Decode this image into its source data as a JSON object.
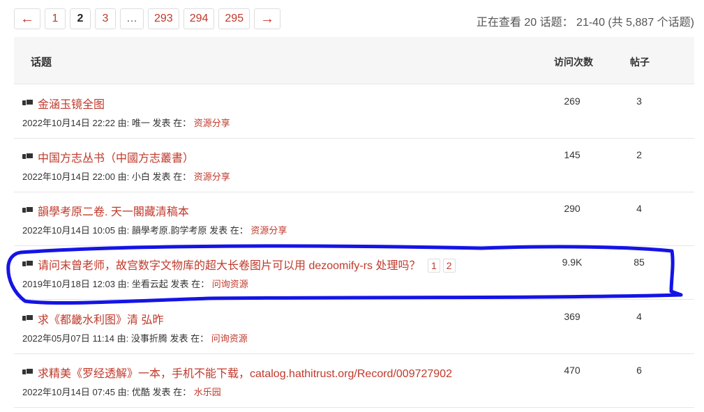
{
  "pagination": {
    "prev": "←",
    "pages": [
      "1",
      "2",
      "3",
      "…",
      "293",
      "294",
      "295"
    ],
    "current": "2",
    "next": "→"
  },
  "viewing_text": "正在查看 20 话题： 21-40 (共 5,887 个话题)",
  "table_header": {
    "topic": "话题",
    "views": "访问次数",
    "posts": "帖子"
  },
  "rows": [
    {
      "title": "金涵玉镜全图",
      "date": "2022年10月14日 22:22",
      "by": "由:",
      "author": "唯一",
      "posted_in": "发表 在：",
      "forum": "资源分享",
      "views": "269",
      "posts": "3"
    },
    {
      "title": "中国方志丛书（中國方志叢書）",
      "date": "2022年10月14日 22:00",
      "by": "由:",
      "author": "小白",
      "posted_in": "发表 在：",
      "forum": "资源分享",
      "views": "145",
      "posts": "2"
    },
    {
      "title": "韻學考原二卷. 天一閣藏清稿本",
      "date": "2022年10月14日 10:05",
      "by": "由:",
      "author": "韻學考原.韵学考原",
      "posted_in": "发表 在：",
      "forum": "资源分享",
      "views": "290",
      "posts": "4"
    },
    {
      "title": "请问末曾老师，故宫数字文物库的超大长卷图片可以用 dezoomify-rs 处理吗？",
      "subpages": [
        "1",
        "2"
      ],
      "date": "2019年10月18日 12:03",
      "by": "由:",
      "author": "坐看云起",
      "posted_in": "发表 在：",
      "forum": "问询资源",
      "views": "9.9K",
      "posts": "85"
    },
    {
      "title": "求《都畿水利图》清 弘昨",
      "date": "2022年05月07日 11:14",
      "by": "由:",
      "author": "没事折腾",
      "posted_in": "发表 在：",
      "forum": "问询资源",
      "views": "369",
      "posts": "4"
    },
    {
      "title": "求精美《罗经透解》一本，手机不能下载，catalog.hathitrust.org/Record/009727902",
      "date": "2022年10月14日 07:45",
      "by": "由:",
      "author": "优酷",
      "posted_in": "发表 在：",
      "forum": "水乐园",
      "views": "470",
      "posts": "6"
    }
  ],
  "colors": {
    "link": "#c0392b",
    "annotation": "#1414e6"
  },
  "icons": [
    "topic-icon"
  ]
}
